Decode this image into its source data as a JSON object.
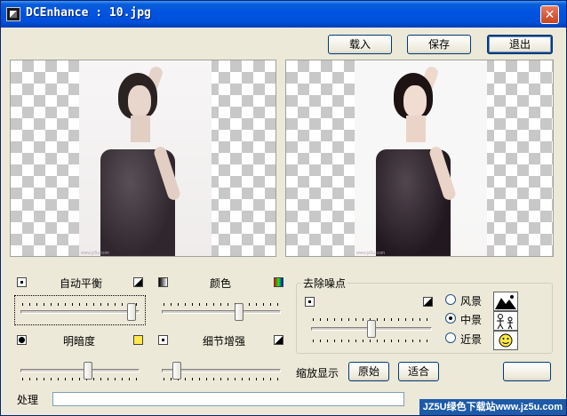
{
  "window": {
    "title": "DCEnhance : 10.jpg"
  },
  "toolbar": {
    "load_label": "载入",
    "save_label": "保存",
    "exit_label": "退出"
  },
  "controls": {
    "auto_balance": {
      "label": "自动平衡",
      "value_fraction": 0.97
    },
    "color": {
      "label": "颜色",
      "value_fraction": 0.66
    },
    "brightness": {
      "label": "明暗度",
      "value_fraction": 0.57
    },
    "detail": {
      "label": "细节增强",
      "value_fraction": 0.1
    }
  },
  "denoise": {
    "group_title": "去除噪点",
    "value_fraction": 0.5,
    "options": [
      {
        "label": "风景",
        "checked": false,
        "icon": "mountain-scene-icon"
      },
      {
        "label": "中景",
        "checked": true,
        "icon": "people-scene-icon"
      },
      {
        "label": "近景",
        "checked": false,
        "icon": "smiley-face-icon"
      }
    ]
  },
  "zoom": {
    "label": "缩放显示",
    "original_label": "原始",
    "fit_label": "适合"
  },
  "status": {
    "label": "处理"
  },
  "watermark": "JZ5U绿色下载站www.jz5u.com",
  "photo_watermark": "www.jz5u.com"
}
